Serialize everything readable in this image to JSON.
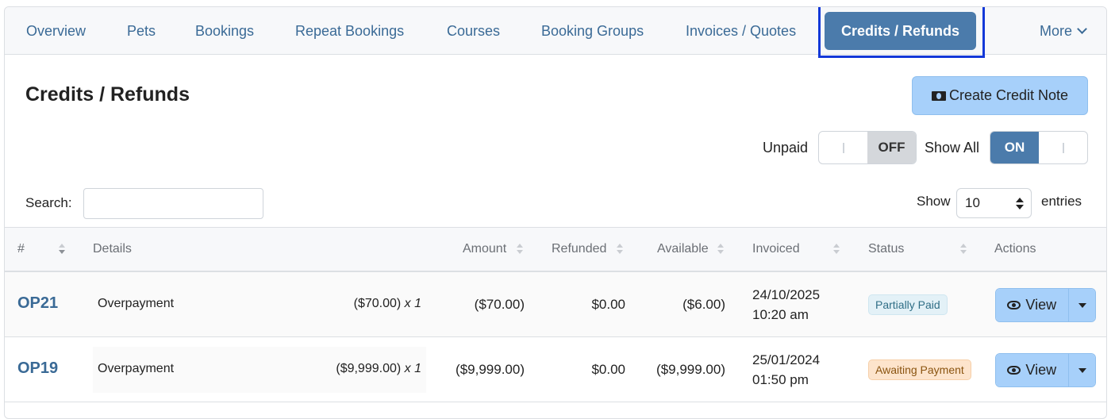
{
  "tabs": [
    {
      "label": "Overview"
    },
    {
      "label": "Pets"
    },
    {
      "label": "Bookings"
    },
    {
      "label": "Repeat Bookings"
    },
    {
      "label": "Courses"
    },
    {
      "label": "Booking Groups"
    },
    {
      "label": "Invoices / Quotes"
    },
    {
      "label": "Credits / Refunds",
      "active": true
    },
    {
      "label": "More"
    }
  ],
  "page": {
    "title": "Credits / Refunds",
    "create_button": "Create Credit Note"
  },
  "filters": {
    "unpaid_label": "Unpaid",
    "unpaid_state": "OFF",
    "show_all_label": "Show All",
    "show_all_state": "ON"
  },
  "search": {
    "label": "Search:",
    "value": ""
  },
  "entries": {
    "show_label": "Show",
    "value": "10",
    "suffix": "entries"
  },
  "table": {
    "headers": [
      "#",
      "Details",
      "Amount",
      "Refunded",
      "Available",
      "Invoiced",
      "Status",
      "Actions"
    ],
    "rows": [
      {
        "ref": "OP21",
        "description": "Overpayment",
        "line_amount": "($70.00)",
        "qty": "x 1",
        "amount": "($70.00)",
        "refunded": "$0.00",
        "available": "($6.00)",
        "invoiced_date": "24/10/2025",
        "invoiced_time": "10:20 am",
        "status": "Partially Paid",
        "action": "View"
      },
      {
        "ref": "OP19",
        "description": "Overpayment",
        "line_amount": "($9,999.00)",
        "qty": "x 1",
        "amount": "($9,999.00)",
        "refunded": "$0.00",
        "available": "($9,999.00)",
        "invoiced_date": "25/01/2024",
        "invoiced_time": "01:50 pm",
        "status": "Awaiting Payment",
        "action": "View"
      }
    ]
  },
  "colors": {
    "accent": "#4b7bab",
    "link": "#3a6a96",
    "button_light": "#a7d0fa",
    "focus_ring": "#1338d8"
  }
}
